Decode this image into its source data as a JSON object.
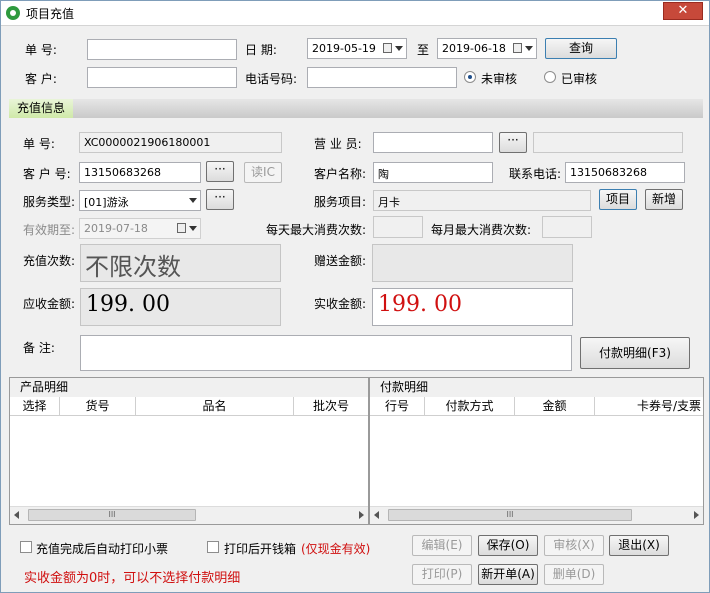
{
  "window": {
    "title": "项目充值",
    "close": "✕"
  },
  "filter": {
    "order_no_label": "单    号:",
    "order_no_value": "",
    "date_label": "日    期:",
    "date_from": "2019-05-19",
    "to_label": "至",
    "date_to": "2019-06-18",
    "query_button": "查询",
    "customer_label": "客    户:",
    "customer_value": "",
    "phone_label": "电话号码:",
    "phone_value": "",
    "status_options": [
      "未审核",
      "已审核"
    ],
    "status_selected": "未审核"
  },
  "section": {
    "title": "充值信息"
  },
  "form": {
    "doc_no_label": "单    号:",
    "doc_no": "XC0000021906180001",
    "salesperson_label": "营 业 员:",
    "salesperson": "",
    "salesperson_extra": "",
    "card_no_label": "客 户 号:",
    "card_no": "13150683268",
    "read_ic_button": "读IC",
    "customer_name_label": "客户名称:",
    "customer_name": "陶",
    "contact_phone_label": "联系电话:",
    "contact_phone": "13150683268",
    "service_type_label": "服务类型:",
    "service_type": "[01]游泳",
    "service_item_label": "服务项目:",
    "service_item": "月卡",
    "item_button": "项目",
    "add_button": "新增",
    "valid_until_label": "有效期至:",
    "valid_until": "2019-07-18",
    "daily_max_label": "每天最大消费次数:",
    "daily_max": "",
    "monthly_max_label": "每月最大消费次数:",
    "monthly_max": "",
    "times_label": "充值次数:",
    "times": "不限次数",
    "gift_label": "赠送金额:",
    "gift_amount": "",
    "receivable_label": "应收金额:",
    "receivable": "199. 00",
    "received_label": "实收金额:",
    "received": "199. 00",
    "remark_label": "备    注:",
    "remark": "",
    "payment_detail_button": "付款明细(F3)"
  },
  "product_grid": {
    "caption": "产品明细",
    "columns": [
      "选择",
      "货号",
      "品名",
      "批次号"
    ]
  },
  "payment_grid": {
    "caption": "付款明细",
    "columns": [
      "行号",
      "付款方式",
      "金额",
      "卡券号/支票"
    ]
  },
  "scroll": {
    "grip": "III"
  },
  "footer": {
    "auto_print_label": "充值完成后自动打印小票",
    "open_drawer_label": "打印后开钱箱",
    "cash_only_note": "(仅现金有效)",
    "warning": "实收金额为0时，可以不选择付款明细",
    "edit_button": "编辑(E)",
    "save_button": "保存(O)",
    "audit_button": "审核(X)",
    "exit_button": "退出(X)",
    "print_button": "打印(P)",
    "new_button": "新开单(A)",
    "delete_button": "删单(D)"
  },
  "colors": {
    "accent_red": "#d01010",
    "section_green": "#cfe9a8",
    "title_icon": "#2e9a3e"
  }
}
